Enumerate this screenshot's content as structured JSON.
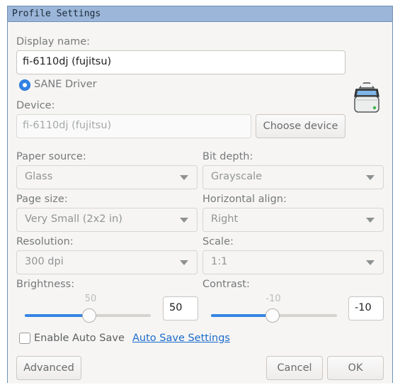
{
  "window": {
    "title": "Profile Settings"
  },
  "display_name": {
    "label": "Display name:",
    "value": "fi-6110dj (fujitsu)"
  },
  "driver": {
    "label": "SANE Driver",
    "selected": true
  },
  "device": {
    "label": "Device:",
    "value": "fi-6110dj (fujitsu)",
    "choose_label": "Choose device"
  },
  "paper_source": {
    "label": "Paper source:",
    "value": "Glass"
  },
  "bit_depth": {
    "label": "Bit depth:",
    "value": "Grayscale"
  },
  "page_size": {
    "label": "Page size:",
    "value": "Very Small (2x2 in)"
  },
  "horizontal_align": {
    "label": "Horizontal align:",
    "value": "Right"
  },
  "resolution": {
    "label": "Resolution:",
    "value": "300 dpi"
  },
  "scale": {
    "label": "Scale:",
    "value": "1:1"
  },
  "brightness": {
    "label": "Brightness:",
    "value_text": "50",
    "spin_value": "50",
    "fraction": 0.51
  },
  "contrast": {
    "label": "Contrast:",
    "value_text": "-10",
    "spin_value": "-10",
    "fraction": 0.49
  },
  "auto_save": {
    "checkbox_label": "Enable Auto Save",
    "checked": false,
    "settings_link": "Auto Save Settings"
  },
  "buttons": {
    "advanced": "Advanced",
    "cancel": "Cancel",
    "ok": "OK"
  },
  "icons": {
    "scanner": "scanner-icon",
    "combo_arrow": "chevron-down-icon"
  },
  "colors": {
    "accent": "#3584e4",
    "titlebar": "#9bb6d8",
    "link": "#1b6acb"
  }
}
